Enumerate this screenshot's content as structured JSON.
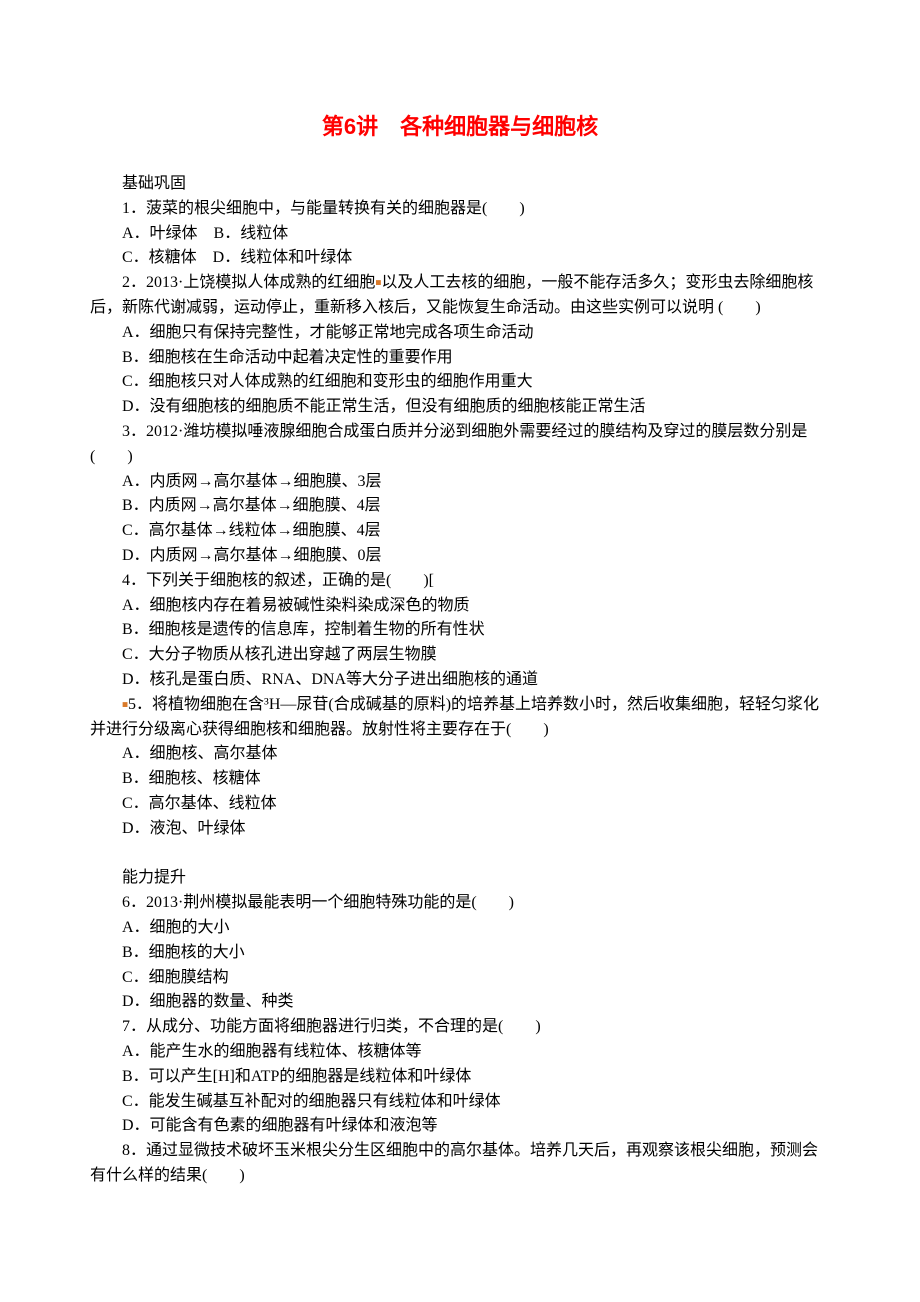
{
  "title": "第6讲　各种细胞器与细胞核",
  "section_basic": "基础巩固",
  "section_ability": "能力提升",
  "q1": {
    "stem": "1．菠菜的根尖细胞中，与能量转换有关的细胞器是(　　)",
    "A": "A．叶绿体　B．线粒体",
    "C": "C．核糖体　D．线粒体和叶绿体"
  },
  "q2": {
    "stem_a": "2．2013·上饶模拟人体成熟的红细胞",
    "stem_b": "以及人工去核的细胞，一般不能存活多久；变形虫去除细胞核后，新陈代谢减弱，运动停止，重新移入核后，又能恢复生命活动。由这些实例可以说明 (　　)",
    "A": "A．细胞只有保持完整性，才能够正常地完成各项生命活动",
    "B": "B．细胞核在生命活动中起着决定性的重要作用",
    "C": "C．细胞核只对人体成熟的红细胞和变形虫的细胞作用重大",
    "D": "D．没有细胞核的细胞质不能正常生活，但没有细胞质的细胞核能正常生活"
  },
  "q3": {
    "stem": "3．2012·潍坊模拟唾液腺细胞合成蛋白质并分泌到细胞外需要经过的膜结构及穿过的膜层数分别是(　　)",
    "A": "A．内质网→高尔基体→细胞膜、3层",
    "B": "B．内质网→高尔基体→细胞膜、4层",
    "C": "C．高尔基体→线粒体→细胞膜、4层",
    "D": "D．内质网→高尔基体→细胞膜、0层"
  },
  "q4": {
    "stem": "4．下列关于细胞核的叙述，正确的是(　　)[",
    "A": "A．细胞核内存在着易被碱性染料染成深色的物质",
    "B": "B．细胞核是遗传的信息库，控制着生物的所有性状",
    "C": "C．大分子物质从核孔进出穿越了两层生物膜",
    "D": "D．核孔是蛋白质、RNA、DNA等大分子进出细胞核的通道"
  },
  "q5": {
    "num": "5",
    "stem": "．将植物细胞在含³H—尿苷(合成碱基的原料)的培养基上培养数小时，然后收集细胞，轻轻匀浆化并进行分级离心获得细胞核和细胞器。放射性将主要存在于(　　)",
    "A": "A．细胞核、高尔基体",
    "B": "B．细胞核、核糖体",
    "C": "C．高尔基体、线粒体",
    "D": "D．液泡、叶绿体"
  },
  "q6": {
    "stem": "6．2013·荆州模拟最能表明一个细胞特殊功能的是(　　)",
    "A": "A．细胞的大小",
    "B": "B．细胞核的大小",
    "C": "C．细胞膜结构",
    "D": "D．细胞器的数量、种类"
  },
  "q7": {
    "stem": "7．从成分、功能方面将细胞器进行归类，不合理的是(　　)",
    "A": "A．能产生水的细胞器有线粒体、核糖体等",
    "B": "B．可以产生[H]和ATP的细胞器是线粒体和叶绿体",
    "C": "C．能发生碱基互补配对的细胞器只有线粒体和叶绿体",
    "D": "D．可能含有色素的细胞器有叶绿体和液泡等"
  },
  "q8": {
    "stem": "8．通过显微技术破坏玉米根尖分生区细胞中的高尔基体。培养几天后，再观察该根尖细胞，预测会有什么样的结果(　　)"
  }
}
